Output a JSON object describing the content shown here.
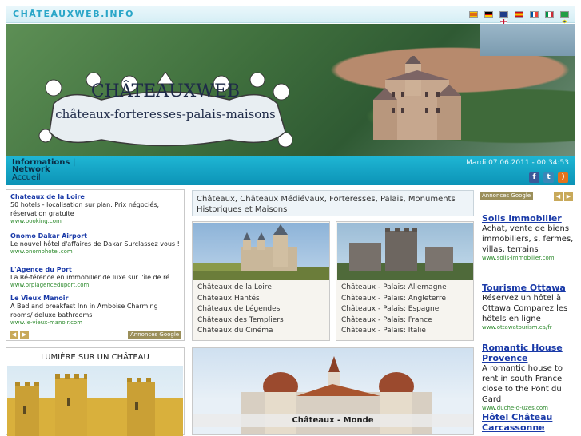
{
  "header": {
    "site_name": "CHÂTEAUXWEB.INFO",
    "languages": [
      "catalan-flag-icon",
      "german-flag-icon",
      "english-flag-icon",
      "spanish-flag-icon",
      "french-flag-icon",
      "italian-flag-icon",
      "portuguese-flag-icon"
    ]
  },
  "banner": {
    "title": "CHÂTEAUXWEB",
    "subtitle": "châteaux-forteresses-palais-maisons"
  },
  "nav": {
    "informations": "Informations |",
    "network": "Network",
    "accueil": "Accueil",
    "datetime": "Mardi 07.06.2011 - 00:34:53",
    "social": [
      "facebook-icon",
      "twitter-icon",
      "rss-icon"
    ]
  },
  "ads_left": {
    "items": [
      {
        "title": "Chateaux de la Loire",
        "desc": "50 hotels - localisation sur plan. Prix négociés, réservation gratuite",
        "url": "www.booking.com"
      },
      {
        "title": "Onomo Dakar Airport",
        "desc": "Le nouvel hôtel d'affaires de Dakar Surclassez vous !",
        "url": "www.onomohotel.com"
      },
      {
        "title": "L'Agence du Port",
        "desc": "La Ré-férence en immobilier de luxe sur l'île de ré",
        "url": "www.orpiagenceduport.com"
      },
      {
        "title": "Le Vieux Manoir",
        "desc": "A Bed and breakfast Inn in Amboise Charming rooms/ deluxe bathrooms",
        "url": "www.le-vieux-manoir.com"
      }
    ],
    "adsby": "Annonces Google"
  },
  "lumiere": {
    "title": "LUMIÈRE SUR UN CHÂTEAU"
  },
  "center": {
    "title": "Châteaux, Châteaux Médiévaux, Forteresses, Palais, Monuments Historiques et Maisons",
    "card1": [
      "Châteaux de la Loire",
      "Châteaux Hantés",
      "Châteaux de Légendes",
      "Châteaux des Templiers",
      "Châteaux du Cinéma"
    ],
    "card2": [
      "Châteaux - Palais: Allemagne",
      "Châteaux - Palais: Angleterre",
      "Châteaux - Palais: Espagne",
      "Châteaux - Palais: France",
      "Châteaux - Palais: Italie"
    ],
    "monde": "Châteaux - Monde"
  },
  "ads_right": {
    "adsby": "Annonces Google",
    "items": [
      {
        "title": "Solis immobilier",
        "desc": "Achat, vente de biens immobiliers, s, fermes, villas, terrains",
        "url": "www.solis-immobilier.com"
      },
      {
        "title": "Tourisme Ottawa",
        "desc": "Réservez un hôtel à Ottawa Comparez les hôtels en ligne",
        "url": "www.ottawatourism.ca/fr"
      },
      {
        "title": "Romantic House Provence",
        "desc": "A romantic house to rent in south France close to the Pont du Gard",
        "url": "www.duche-d-uzes.com"
      },
      {
        "title": "Hôtel Château Carcassonne",
        "desc": "",
        "url": ""
      }
    ]
  }
}
